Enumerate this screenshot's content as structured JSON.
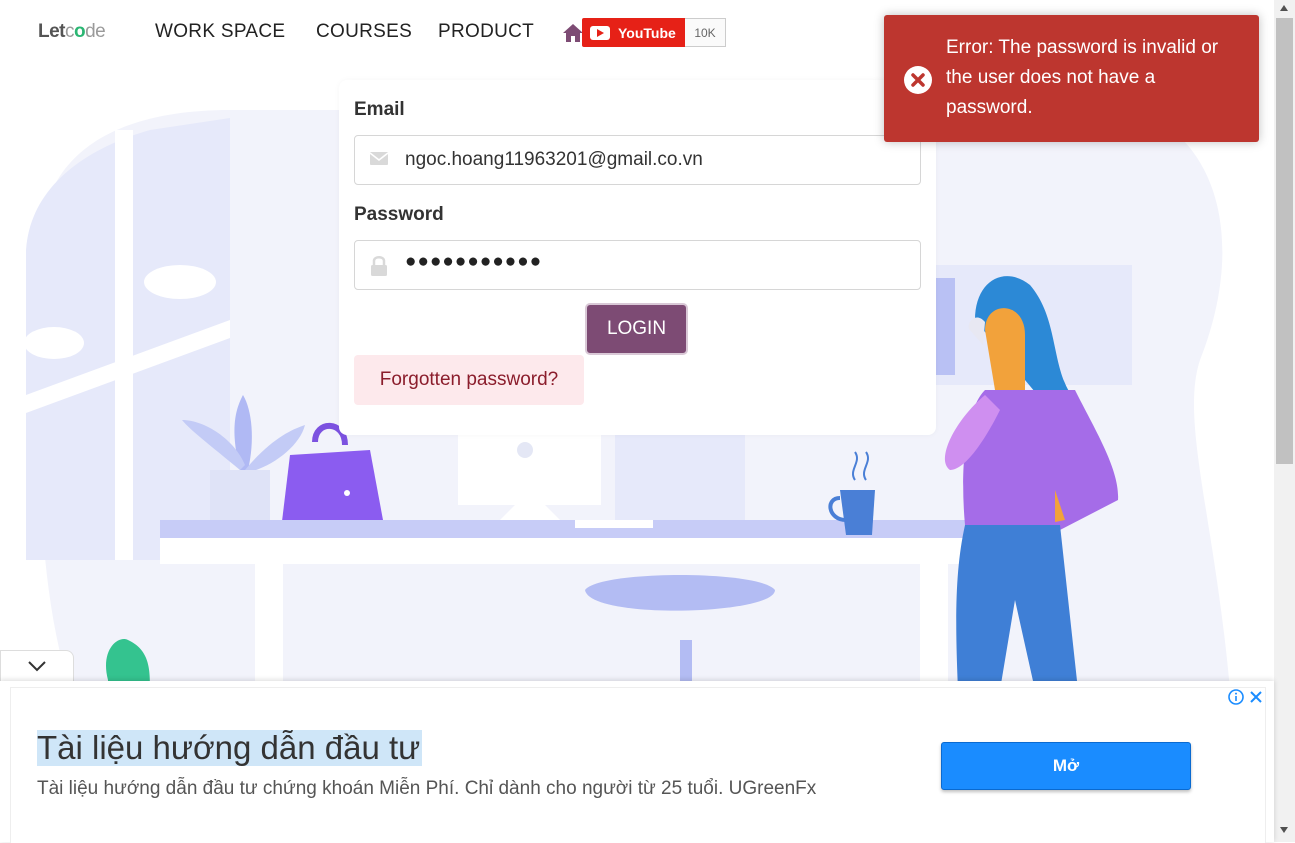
{
  "header": {
    "logo": {
      "let": "Let",
      "c": "c",
      "o": "o",
      "de": "de"
    },
    "nav": [
      "WORK SPACE",
      "COURSES",
      "PRODUCT"
    ],
    "youtube_label": "YouTube",
    "youtube_count": "10K"
  },
  "login": {
    "email_label": "Email",
    "email_value": "ngoc.hoang11963201@gmail.co.vn",
    "password_label": "Password",
    "password_value": "●●●●●●●●●●●",
    "login_button": "LOGIN",
    "forgot_link": "Forgotten password?"
  },
  "toast": {
    "message": "Error: The password is invalid or the user does not have a password.",
    "color": "#bd362f"
  },
  "ad": {
    "title": "Tài liệu hướng dẫn đầu tư",
    "description": "Tài liệu hướng dẫn đầu tư chứng khoán Miễn Phí. Chỉ dành cho người từ 25 tuổi. UGreenFx",
    "button": "Mở",
    "button_color": "#1a8cff"
  },
  "colors": {
    "accent": "#7d4b74",
    "forgot_bg": "#fde9ec",
    "youtube_red": "#e62117"
  }
}
